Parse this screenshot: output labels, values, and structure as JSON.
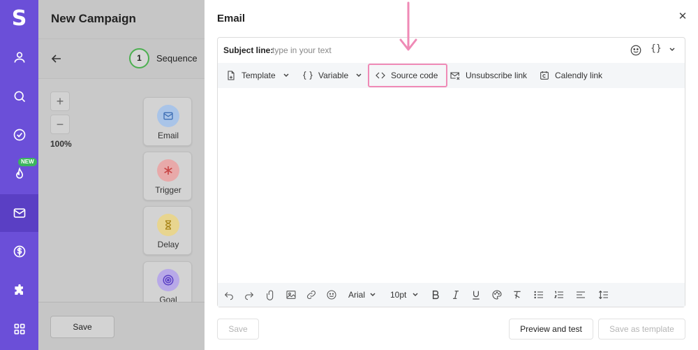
{
  "app": {
    "logo_letter": "S"
  },
  "nav": {
    "items": [
      {
        "name": "profile",
        "icon": "user-icon"
      },
      {
        "name": "search",
        "icon": "search-icon"
      },
      {
        "name": "tasks",
        "icon": "check-circle-icon"
      },
      {
        "name": "warm-up",
        "icon": "flame-icon",
        "badge": "NEW"
      },
      {
        "name": "email-campaigns",
        "icon": "envelope-icon",
        "active": true
      },
      {
        "name": "billing",
        "icon": "dollar-icon"
      },
      {
        "name": "integrations",
        "icon": "puzzle-icon"
      },
      {
        "name": "apps",
        "icon": "grid-icon"
      }
    ],
    "colors": {
      "rail": "#6b4fd8",
      "active": "#5a3fc4"
    }
  },
  "campaign": {
    "title": "New Campaign",
    "step": {
      "number": "1",
      "label": "Sequence"
    },
    "zoom": {
      "plus": "+",
      "minus": "−",
      "level": "100%"
    },
    "nodes": [
      {
        "label": "Email",
        "icon": "envelope-icon",
        "color": "#a9c4e8"
      },
      {
        "label": "Trigger",
        "icon": "asterisk-icon",
        "color": "#e8a9a9"
      },
      {
        "label": "Delay",
        "icon": "hourglass-icon",
        "color": "#e8d58f"
      },
      {
        "label": "Goal",
        "icon": "target-icon",
        "color": "#b8a9e8"
      }
    ],
    "save_label": "Save"
  },
  "email_panel": {
    "title": "Email",
    "close_icon": "close-icon",
    "subject": {
      "label": "Subject line:",
      "placeholder": "type in your text",
      "vars_glyph": "{}"
    },
    "toolbar": {
      "template": "Template",
      "variable": "Variable",
      "source_code": "Source code",
      "unsubscribe": "Unsubscribe link",
      "calendly": "Calendly link"
    },
    "format": {
      "font": "Arial",
      "size": "10pt"
    },
    "buttons": {
      "save": "Save",
      "preview": "Preview and test",
      "save_template": "Save as template"
    },
    "highlight_color": "#ef8ab6"
  }
}
